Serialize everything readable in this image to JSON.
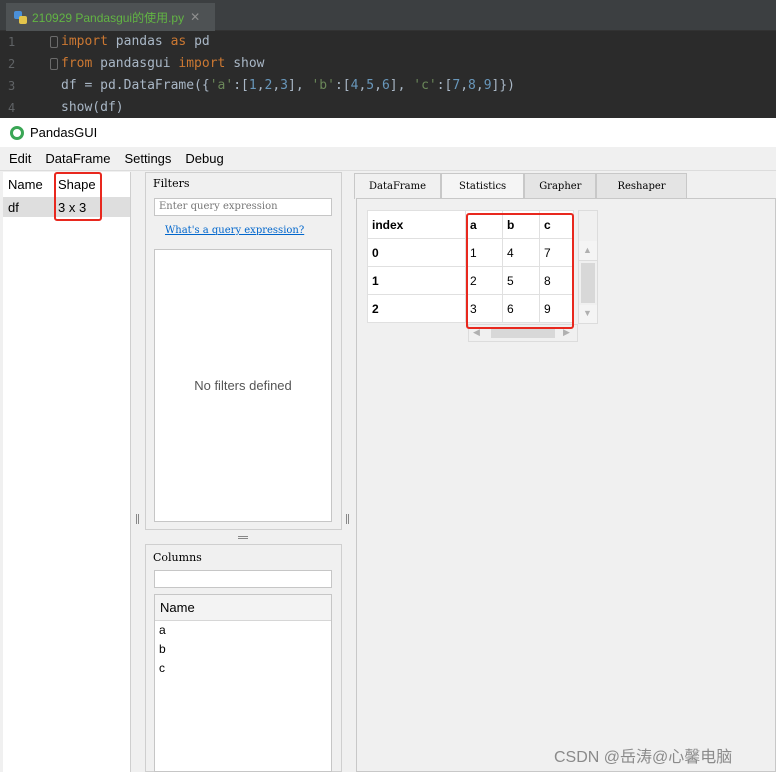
{
  "editor": {
    "tab_title": "210929 Pandasgui的使用.py",
    "tab_close": "✕",
    "lines": [
      {
        "num": "1",
        "parts": [
          [
            "kw",
            "import"
          ],
          [
            "t",
            " pandas "
          ],
          [
            "kw",
            "as"
          ],
          [
            "t",
            " pd"
          ]
        ]
      },
      {
        "num": "2",
        "parts": [
          [
            "kw",
            "from"
          ],
          [
            "t",
            " pandasgui "
          ],
          [
            "kw",
            "import"
          ],
          [
            "t",
            " show"
          ]
        ]
      },
      {
        "num": "3",
        "parts": [
          [
            "t",
            "df = pd.DataFrame({"
          ],
          [
            "str",
            "'a'"
          ],
          [
            "t",
            ":["
          ],
          [
            "num",
            "1"
          ],
          [
            "t",
            ","
          ],
          [
            "num",
            "2"
          ],
          [
            "t",
            ","
          ],
          [
            "num",
            "3"
          ],
          [
            "t",
            "], "
          ],
          [
            "str",
            "'b'"
          ],
          [
            "t",
            ":["
          ],
          [
            "num",
            "4"
          ],
          [
            "t",
            ","
          ],
          [
            "num",
            "5"
          ],
          [
            "t",
            ","
          ],
          [
            "num",
            "6"
          ],
          [
            "t",
            "], "
          ],
          [
            "str",
            "'c'"
          ],
          [
            "t",
            ":["
          ],
          [
            "num",
            "7"
          ],
          [
            "t",
            ","
          ],
          [
            "num",
            "8"
          ],
          [
            "t",
            ","
          ],
          [
            "num",
            "9"
          ],
          [
            "t",
            "]})"
          ]
        ]
      },
      {
        "num": "4",
        "parts": [
          [
            "t",
            "show(df)"
          ]
        ]
      }
    ]
  },
  "app": {
    "title": "PandasGUI",
    "menu": [
      "Edit",
      "DataFrame",
      "Settings",
      "Debug"
    ]
  },
  "dataframe_list": {
    "headers": [
      "Name",
      "Shape"
    ],
    "rows": [
      [
        "df",
        "3 x 3"
      ]
    ]
  },
  "filters": {
    "title": "Filters",
    "placeholder": "Enter query expression",
    "help_link": "What's a query expression?",
    "empty_message": "No filters defined"
  },
  "columns": {
    "title": "Columns",
    "header": "Name",
    "items": [
      "a",
      "b",
      "c"
    ]
  },
  "tabs": [
    "DataFrame",
    "Statistics",
    "Grapher",
    "Reshaper"
  ],
  "table": {
    "headers": [
      "index",
      "a",
      "b",
      "c"
    ],
    "rows": [
      [
        "0",
        "1",
        "4",
        "7"
      ],
      [
        "1",
        "2",
        "5",
        "8"
      ],
      [
        "2",
        "3",
        "6",
        "9"
      ]
    ]
  },
  "colors": {
    "highlight_box": "#e8281e",
    "link": "#0066cc"
  },
  "watermark": "CSDN @岳涛@心馨电脑"
}
